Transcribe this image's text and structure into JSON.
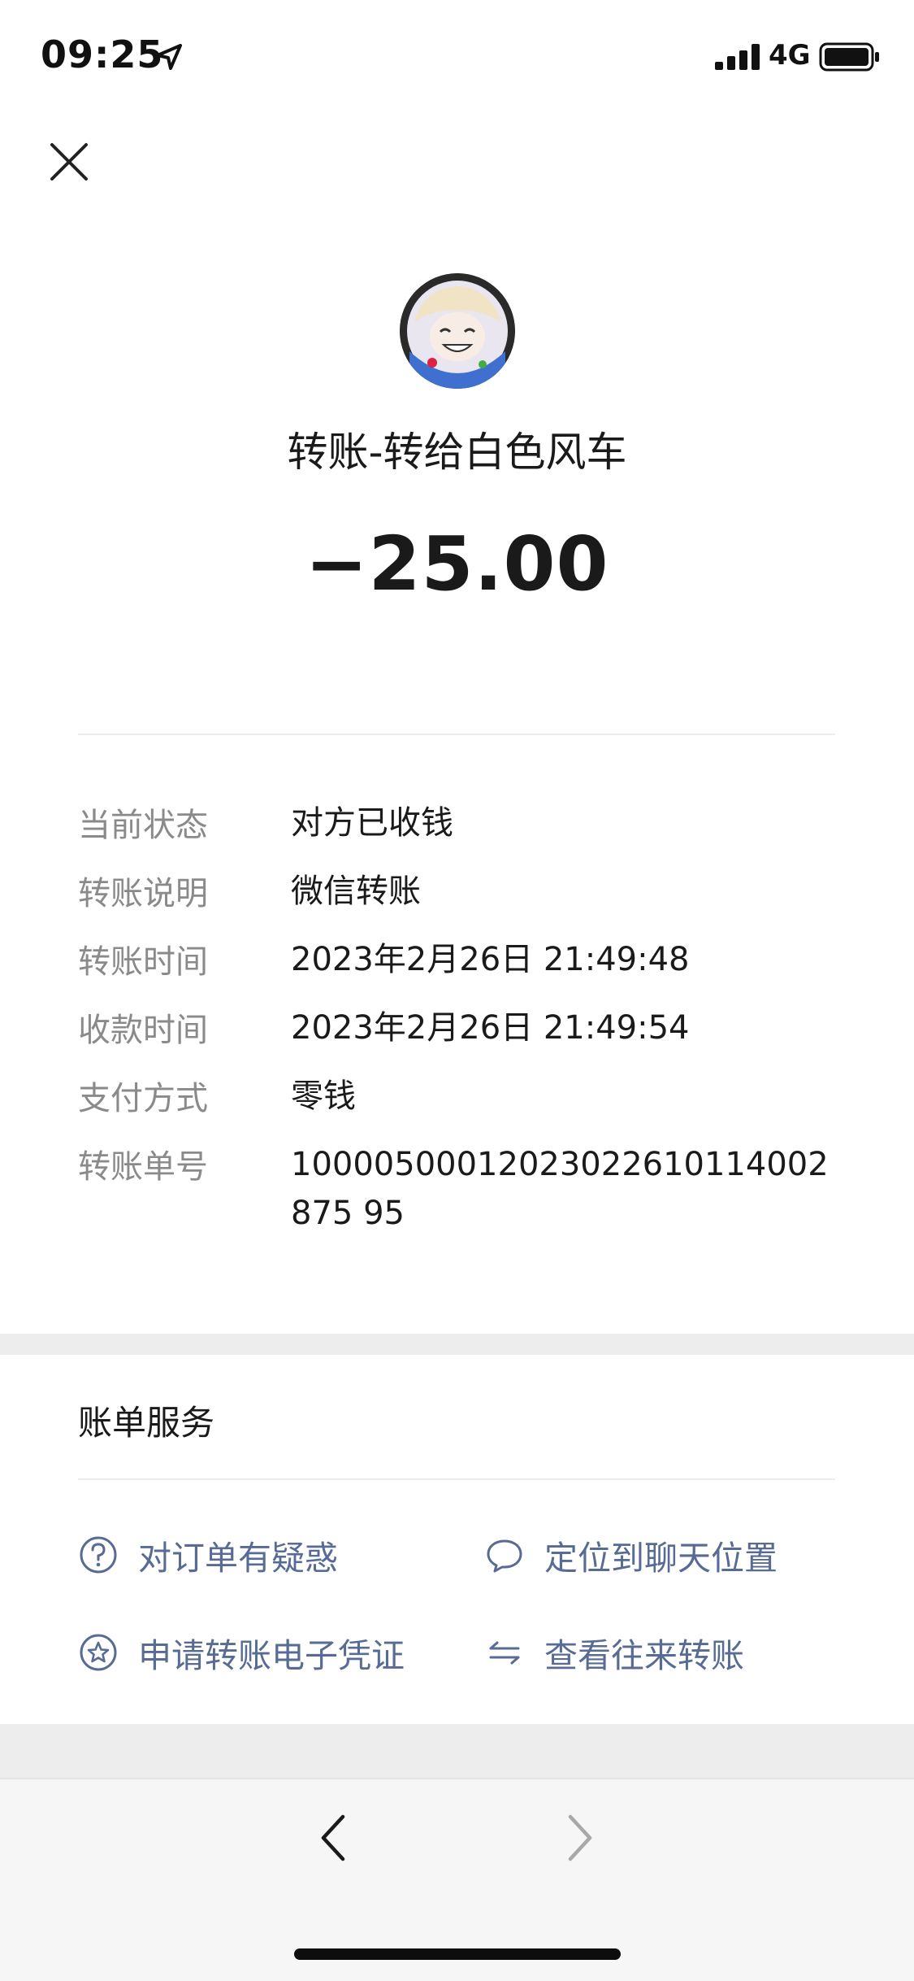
{
  "status_bar": {
    "time": "09:25",
    "network": "4G",
    "location_icon": "location-arrow-icon",
    "signal_icon": "signal-bars-icon",
    "battery_icon": "battery-icon"
  },
  "header": {
    "close_icon": "close-icon",
    "avatar": "avatar",
    "title": "转账-转给白色风车",
    "amount": "−25.00"
  },
  "details": [
    {
      "label": "当前状态",
      "value": "对方已收钱"
    },
    {
      "label": "转账说明",
      "value": "微信转账"
    },
    {
      "label": "转账时间",
      "value": "2023年2月26日 21:49:48"
    },
    {
      "label": "收款时间",
      "value": "2023年2月26日 21:49:54"
    },
    {
      "label": "支付方式",
      "value": "零钱"
    },
    {
      "label": "转账单号",
      "value": "10000500012023022610114002875 95"
    }
  ],
  "bill_services": {
    "title": "账单服务",
    "items": [
      {
        "label": "对订单有疑惑",
        "icon": "question-circle-icon"
      },
      {
        "label": "定位到聊天位置",
        "icon": "chat-bubble-icon"
      },
      {
        "label": "申请转账电子凭证",
        "icon": "star-circle-icon"
      },
      {
        "label": "查看往来转账",
        "icon": "transfer-arrows-icon"
      }
    ]
  },
  "bottom_nav": {
    "back_icon": "chevron-left-icon",
    "forward_icon": "chevron-right-icon"
  },
  "colors": {
    "link": "#576b95",
    "label_gray": "#8a8a8a",
    "band_gray": "#ededed"
  }
}
